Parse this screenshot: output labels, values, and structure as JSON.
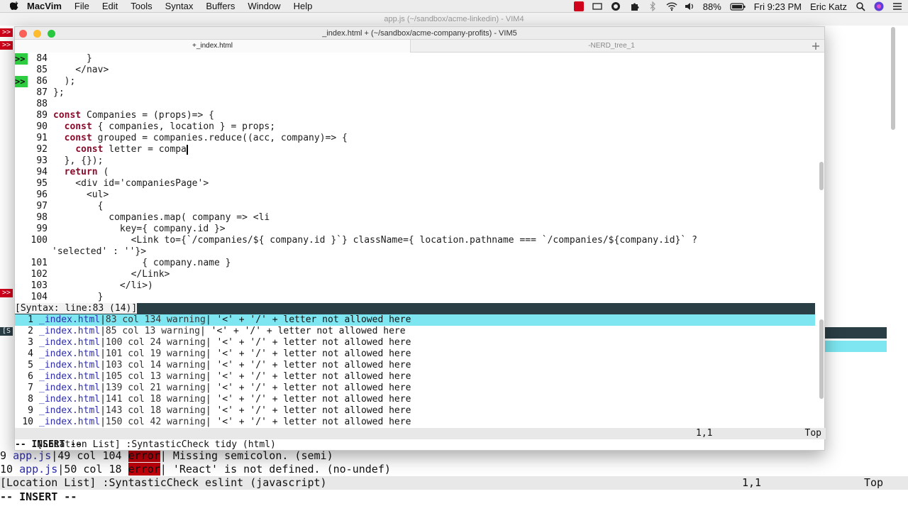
{
  "menubar": {
    "app": "MacVim",
    "items": [
      "File",
      "Edit",
      "Tools",
      "Syntax",
      "Buffers",
      "Window",
      "Help"
    ],
    "battery": "88%",
    "clock": "Fri 9:23 PM",
    "user": "Eric Katz"
  },
  "bg_window": {
    "title": "app.js (~/sandbox/acme-linkedin) - VIM4",
    "qf_lines": [
      {
        "num": "9",
        "file": "app.js",
        "loc": "49 col 104",
        "type": "error",
        "msg": " Missing semicolon. (semi)"
      },
      {
        "num": "10",
        "file": "app.js",
        "loc": "50 col 18",
        "type": "error",
        "msg": " 'React' is not defined. (no-undef)"
      }
    ],
    "status_left": "[Location List] :SyntasticCheck eslint (javascript)",
    "status_pos": "1,1",
    "status_top": "Top",
    "mode": "-- INSERT --"
  },
  "window": {
    "title": "_index.html + (~/sandbox/acme-company-profits) - VIM5",
    "tabs": [
      {
        "label": "+_index.html",
        "active": true
      },
      {
        "label": "-NERD_tree_1",
        "active": false
      }
    ]
  },
  "code_lines": [
    {
      "n": "84",
      "sign": ">>",
      "html": "      }"
    },
    {
      "n": "85",
      "sign": "",
      "html": "    </nav>"
    },
    {
      "n": "86",
      "sign": ">>",
      "html": "  );"
    },
    {
      "n": "87",
      "sign": "",
      "html": "};"
    },
    {
      "n": "88",
      "sign": "",
      "html": ""
    },
    {
      "n": "89",
      "sign": "",
      "html": "const Companies = (props)=> {"
    },
    {
      "n": "90",
      "sign": "",
      "html": "  const { companies, location } = props;"
    },
    {
      "n": "91",
      "sign": "",
      "html": "  const grouped = companies.reduce((acc, company)=> {"
    },
    {
      "n": "92",
      "sign": "",
      "html": "    const letter = compa"
    },
    {
      "n": "93",
      "sign": "",
      "html": "  }, {});"
    },
    {
      "n": "94",
      "sign": "",
      "html": "  return ("
    },
    {
      "n": "95",
      "sign": "",
      "html": "    <div id='companiesPage'>"
    },
    {
      "n": "96",
      "sign": "",
      "html": "      <ul>"
    },
    {
      "n": "97",
      "sign": "",
      "html": "        {"
    },
    {
      "n": "98",
      "sign": "",
      "html": "          companies.map( company => <li"
    },
    {
      "n": "99",
      "sign": "",
      "html": "            key={ company.id }>"
    },
    {
      "n": "100",
      "sign": "",
      "html": "              <Link to={`/companies/${ company.id }`} className={ location.pathname === `/companies/${company.id}` ?"
    },
    {
      "n": "",
      "sign": "",
      "html": "'selected' : ''}>"
    },
    {
      "n": "101",
      "sign": "",
      "html": "                { company.name }"
    },
    {
      "n": "102",
      "sign": "",
      "html": "              </Link>"
    },
    {
      "n": "103",
      "sign": "",
      "html": "            </li>)"
    },
    {
      "n": "104",
      "sign": "",
      "html": "        }"
    }
  ],
  "syntax_status": "[Syntax: line:83 (14)]",
  "loclist": [
    {
      "idx": "1",
      "file": "_index.html",
      "loc": "83 col 134 warning",
      "msg": " '<' + '/' + letter not allowed here"
    },
    {
      "idx": "2",
      "file": "_index.html",
      "loc": "85 col 13 warning",
      "msg": " '<' + '/' + letter not allowed here"
    },
    {
      "idx": "3",
      "file": "_index.html",
      "loc": "100 col 24 warning",
      "msg": " '<' + '/' + letter not allowed here"
    },
    {
      "idx": "4",
      "file": "_index.html",
      "loc": "101 col 19 warning",
      "msg": " '<' + '/' + letter not allowed here"
    },
    {
      "idx": "5",
      "file": "_index.html",
      "loc": "103 col 14 warning",
      "msg": " '<' + '/' + letter not allowed here"
    },
    {
      "idx": "6",
      "file": "_index.html",
      "loc": "105 col 13 warning",
      "msg": " '<' + '/' + letter not allowed here"
    },
    {
      "idx": "7",
      "file": "_index.html",
      "loc": "139 col 21 warning",
      "msg": " '<' + '/' + letter not allowed here"
    },
    {
      "idx": "8",
      "file": "_index.html",
      "loc": "141 col 18 warning",
      "msg": " '<' + '/' + letter not allowed here"
    },
    {
      "idx": "9",
      "file": "_index.html",
      "loc": "143 col 18 warning",
      "msg": " '<' + '/' + letter not allowed here"
    },
    {
      "idx": "10",
      "file": "_index.html",
      "loc": "150 col 42 warning",
      "msg": " '<' + '/' + letter not allowed here"
    }
  ],
  "loc_status": {
    "left": "[Location List] :SyntasticCheck tidy (html)",
    "pos": "1,1",
    "top": "Top"
  },
  "mode": "-- INSERT --"
}
